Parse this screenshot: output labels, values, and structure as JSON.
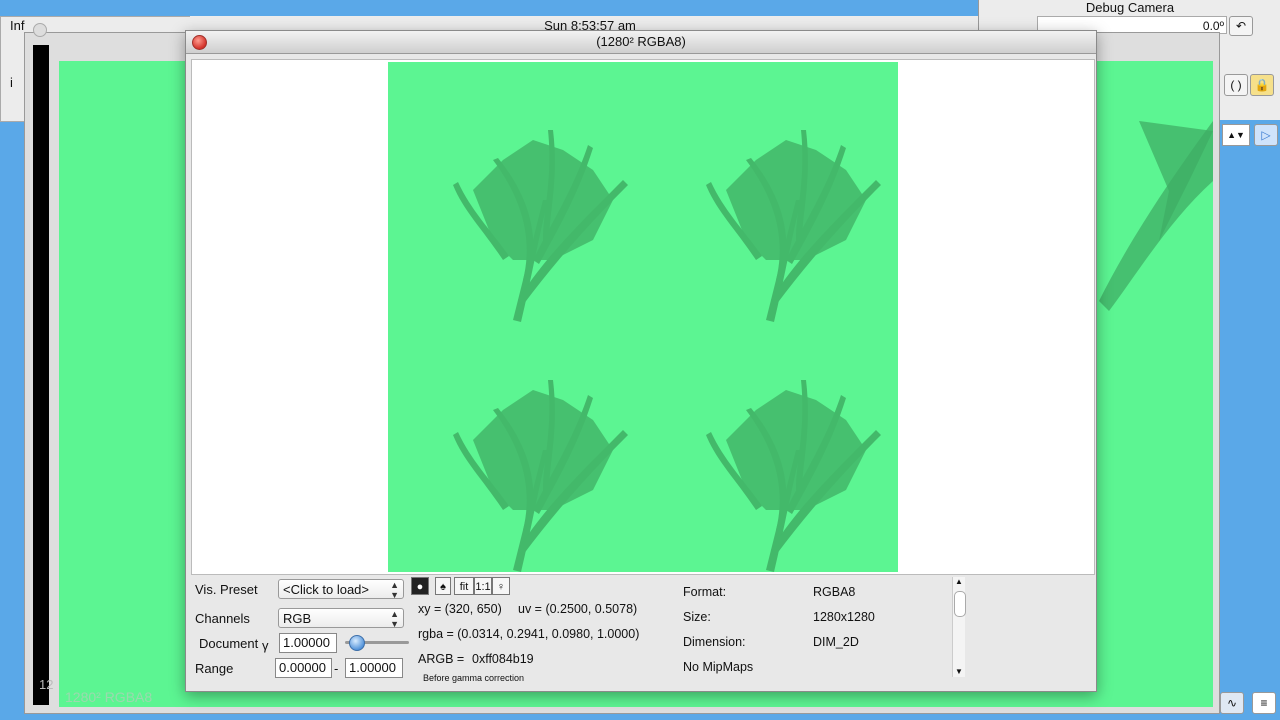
{
  "background": {
    "info_window": {
      "title_partial": "Inf",
      "label_partial": "i"
    },
    "clock": "Sun 8:53:57 am",
    "debug_camera": {
      "title": "Debug Camera",
      "field_value": "0.0º"
    },
    "back_window": {
      "label": "1280² RGBA8",
      "corner_text": "12"
    }
  },
  "window": {
    "title": "(1280² RGBA8)"
  },
  "controls": {
    "vis_preset_label": "Vis. Preset",
    "vis_preset_value": "<Click to load>",
    "channels_label": "Channels",
    "channels_value": "RGB",
    "document_label": "Document",
    "gamma_symbol": "γ",
    "gamma_value": "1.00000",
    "gamma_slider_level": 0.1,
    "range_label": "Range",
    "range_min": "0.00000",
    "range_dash": "-",
    "range_max": "1.00000",
    "buttons": {
      "fit": "fit",
      "one_to_one": "1:1"
    }
  },
  "pixel_info": {
    "xy": "xy =  (320, 650)",
    "uv": "uv =  (0.2500, 0.5078)",
    "rgba": "rgba =  (0.0314, 0.2941, 0.0980, 1.0000)",
    "argb_label": "ARGB =",
    "argb_value": "0xff084b19",
    "note": "Before gamma correction"
  },
  "texture_info": {
    "format_label": "Format:",
    "format_value": "RGBA8",
    "size_label": "Size:",
    "size_value": "1280x1280",
    "dimension_label": "Dimension:",
    "dimension_value": "DIM_2D",
    "mipmaps": "No MipMaps"
  },
  "colors": {
    "texture_green": "#5cf592",
    "plant_green": "#3fae64"
  },
  "icons": {
    "close": "close-icon",
    "lock": "lock-icon",
    "curly_braces": "braces-icon",
    "play": "play-icon",
    "activity": "activity-monitor-icon",
    "notes": "notes-icon"
  }
}
